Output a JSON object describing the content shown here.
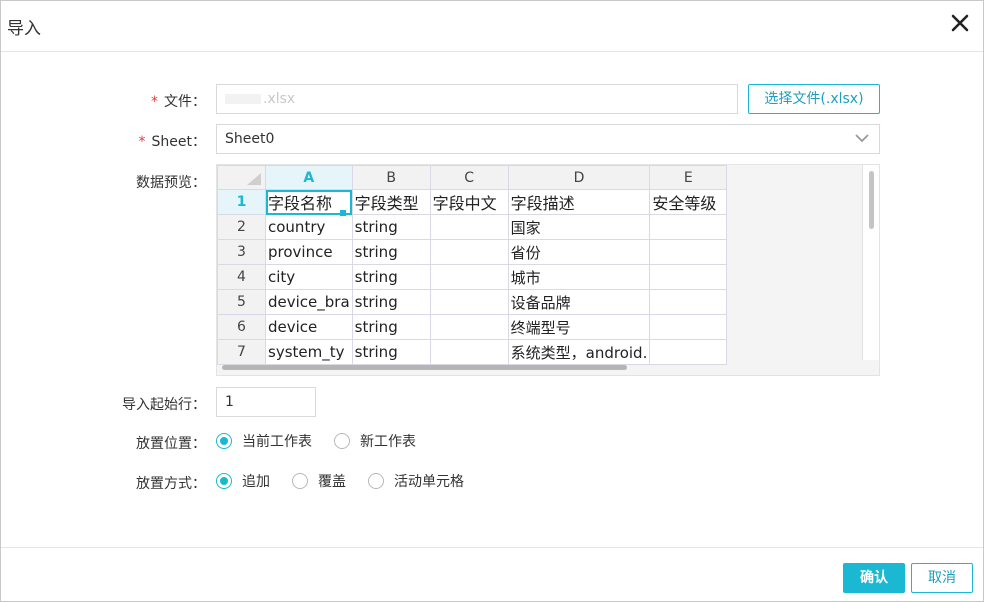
{
  "dialog": {
    "title": "导入"
  },
  "file": {
    "label": "文件：",
    "required_mark": "*",
    "value": ".xlsx",
    "choose_button": "选择文件(.xlsx)"
  },
  "sheet": {
    "label": "Sheet：",
    "required_mark": "*",
    "selected": "Sheet0"
  },
  "preview": {
    "label": "数据预览：",
    "columns": [
      "A",
      "B",
      "C",
      "D",
      "E"
    ],
    "rows": [
      {
        "num": "1",
        "cells": [
          "字段名称",
          "字段类型",
          "字段中文",
          "字段描述",
          "安全等级"
        ]
      },
      {
        "num": "2",
        "cells": [
          "country",
          "string",
          "",
          "国家",
          ""
        ]
      },
      {
        "num": "3",
        "cells": [
          "province",
          "string",
          "",
          "省份",
          ""
        ]
      },
      {
        "num": "4",
        "cells": [
          "city",
          "string",
          "",
          "城市",
          ""
        ]
      },
      {
        "num": "5",
        "cells": [
          "device_bra",
          "string",
          "",
          "设备品牌",
          ""
        ]
      },
      {
        "num": "6",
        "cells": [
          "device",
          "string",
          "",
          "终端型号",
          ""
        ]
      },
      {
        "num": "7",
        "cells": [
          "system_ty",
          "string",
          "",
          "系统类型，android.",
          ""
        ]
      }
    ]
  },
  "start_row": {
    "label": "导入起始行：",
    "value": "1"
  },
  "placement": {
    "label": "放置位置：",
    "options": [
      {
        "label": "当前工作表",
        "selected": true
      },
      {
        "label": "新工作表",
        "selected": false
      }
    ]
  },
  "method": {
    "label": "放置方式：",
    "options": [
      {
        "label": "追加",
        "selected": true
      },
      {
        "label": "覆盖",
        "selected": false
      },
      {
        "label": "活动单元格",
        "selected": false
      }
    ]
  },
  "footer": {
    "ok": "确认",
    "cancel": "取消"
  },
  "colors": {
    "accent": "#1bb8d3",
    "required": "#e23c3c"
  }
}
